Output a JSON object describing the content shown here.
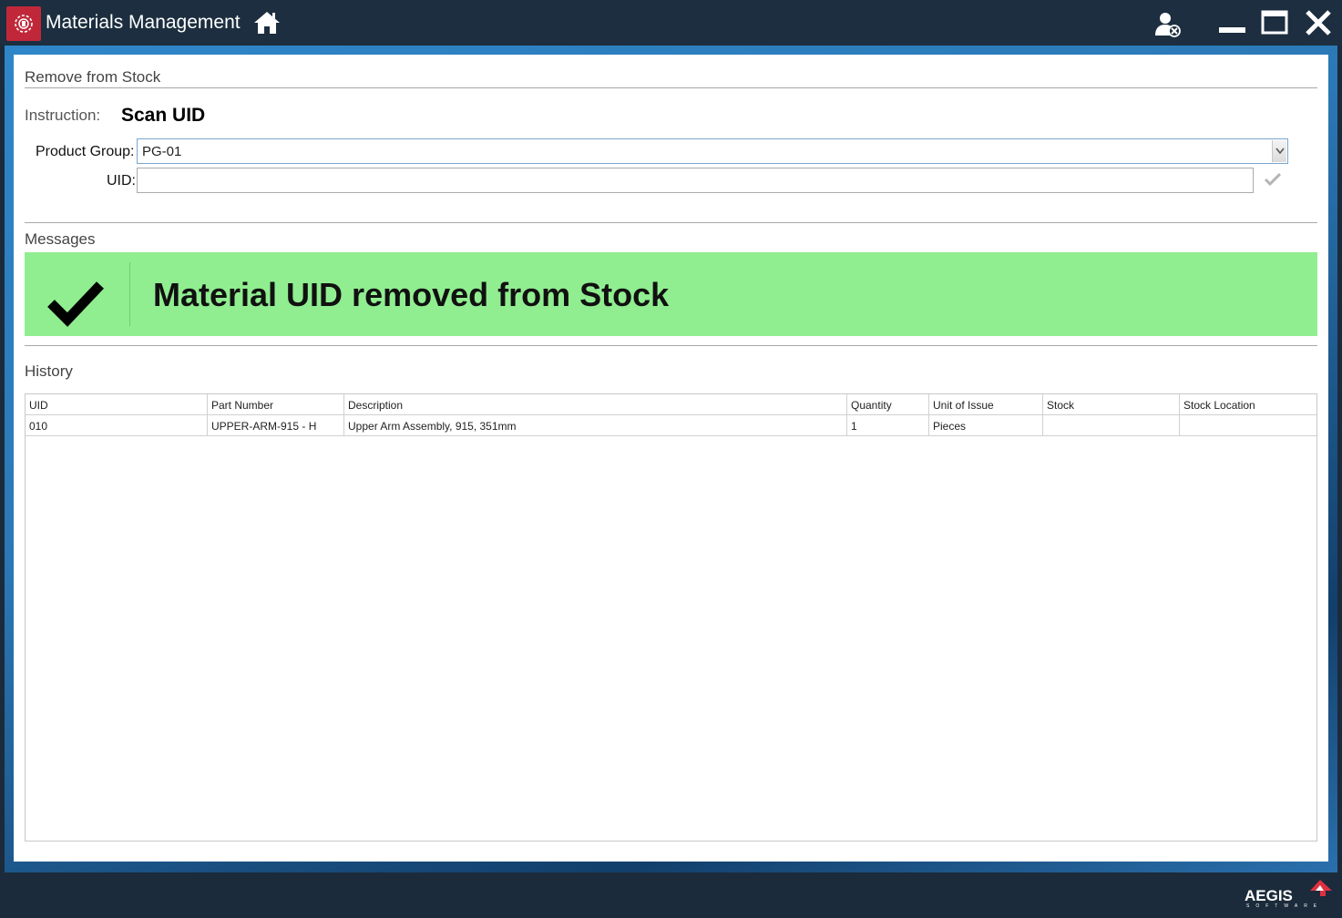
{
  "window": {
    "title": "Materials Management",
    "icons": [
      "app-logo-icon",
      "home-icon",
      "user-logout-icon",
      "minimize-icon",
      "maximize-icon",
      "close-icon"
    ]
  },
  "form": {
    "section_title": "Remove from Stock",
    "instruction_label": "Instruction:",
    "instruction_value": "Scan UID",
    "product_group_label": "Product Group:",
    "product_group_value": "PG-01",
    "uid_label": "UID:",
    "uid_value": ""
  },
  "messages": {
    "section_title": "Messages",
    "text": "Material UID removed from Stock",
    "status": "success",
    "color": "#90ee90"
  },
  "history": {
    "section_title": "History",
    "columns": [
      "UID",
      "Part Number",
      "Description",
      "Quantity",
      "Unit of Issue",
      "Stock",
      "Stock Location"
    ],
    "rows": [
      [
        "010",
        "UPPER-ARM-915 - H",
        "Upper Arm Assembly, 915, 351mm",
        "1",
        "Pieces",
        "",
        ""
      ]
    ]
  },
  "footer": {
    "brand": "AEGIS",
    "brand_sub": "SOFTWARE",
    "accent": "#e03040"
  }
}
